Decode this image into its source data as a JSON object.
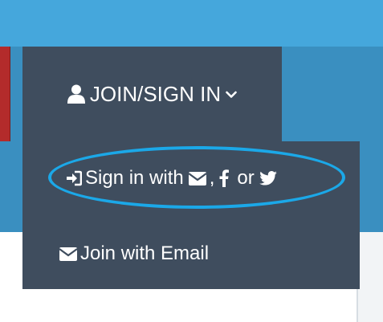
{
  "nav": {
    "join_label": "JOIN/SIGN IN",
    "user_icon": "user-icon",
    "chevron_icon": "chevron-down-icon"
  },
  "dropdown": {
    "sign_in": {
      "prefix": "Sign in with",
      "comma": ",",
      "or": "or",
      "icons": [
        "sign-in-icon",
        "envelope-icon",
        "facebook-icon",
        "twitter-icon"
      ]
    },
    "join": {
      "label": "Join with Email",
      "icon": "envelope-icon"
    }
  },
  "colors": {
    "top_bar": "#45a7dc",
    "band": "#3a8fc0",
    "menu_bg": "#3f4d5e",
    "accent_red": "#b32b2b",
    "highlight": "#1ba8e8"
  }
}
